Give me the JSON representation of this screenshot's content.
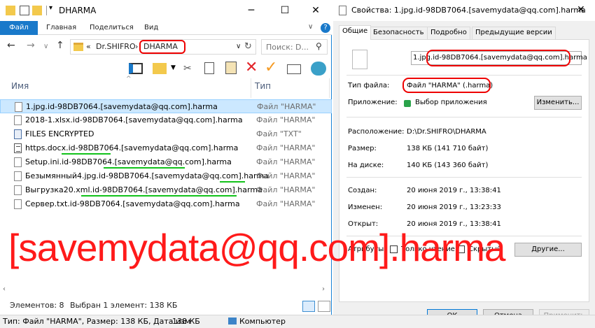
{
  "explorer": {
    "title": "DHARMA",
    "ribbon": {
      "file": "Файл",
      "home": "Главная",
      "share": "Поделиться",
      "view": "Вид",
      "expand": "∨",
      "help": "?"
    },
    "address": {
      "path_sep": "«",
      "parent": "Dr.SHIFRO",
      "arrow": "›",
      "current": "DHARMA"
    },
    "search_placeholder": "Поиск: D...",
    "columns": {
      "name": "Имя",
      "type": "Тип"
    },
    "files": [
      {
        "name": "1.jpg.id-98DB7064.[savemydata@qq.com].harma",
        "type": "Файл \"HARMA\"",
        "selected": true,
        "icon": "file"
      },
      {
        "name": "2018-1.xlsx.id-98DB7064.[savemydata@qq.com].harma",
        "type": "Файл \"HARMA\"",
        "icon": "file"
      },
      {
        "name": "FILES ENCRYPTED",
        "type": "Файл \"TXT\"",
        "icon": "encrypted"
      },
      {
        "name": "https.docx.id-98DB7064.[savemydata@qq.com].harma",
        "type": "Файл \"HARMA\"",
        "icon": "file"
      },
      {
        "name": "Setup.ini.id-98DB7064.[savemydata@qq.com].harma",
        "type": "Файл \"HARMA\"",
        "icon": "file"
      },
      {
        "name": "Безымянный4.jpg.id-98DB7064.[savemydata@qq.com].harma",
        "type": "Файл \"HARMA\"",
        "icon": "file"
      },
      {
        "name": "Выгрузка20.xml.id-98DB7064.[savemydata@qq.com].harma",
        "type": "Файл \"HARMA\"",
        "icon": "file"
      },
      {
        "name": "Сервер.txt.id-98DB7064.[savemydata@qq.com].harma",
        "type": "Файл \"HARMA\"",
        "icon": "file"
      }
    ],
    "status": {
      "count": "Элементов: 8",
      "selected": "Выбран 1 элемент: 138 КБ"
    },
    "overlay_text": "[savemydata@qq.com].harma"
  },
  "bottom_bar": {
    "info": "Тип: Файл \"HARMA\", Размер: 138 КБ, Дата изм",
    "size": "138 КБ",
    "computer": "Компьютер"
  },
  "properties": {
    "title": "Свойства: 1.jpg.id-98DB7064.[savemydata@qq.com].harma",
    "tabs": [
      "Общие",
      "Безопасность",
      "Подробно",
      "Предыдущие версии"
    ],
    "filename": "1.jpg.id-98DB7064.[savemydata@qq.com].harma",
    "file_type_label": "Тип файла:",
    "file_type": "Файл \"HARMA\" (.harma)",
    "app_label": "Приложение:",
    "app_value": "Выбор приложения",
    "change_button": "Изменить...",
    "location_label": "Расположение:",
    "location": "D:\\Dr.SHIFRO\\DHARMA",
    "size_label": "Размер:",
    "size": "138 КБ (141 710 байт)",
    "disk_label": "На диске:",
    "disk": "140 КБ (143 360 байт)",
    "created_label": "Создан:",
    "created": "20 июня 2019 г., 13:38:41",
    "modified_label": "Изменен:",
    "modified": "20 июня 2019 г., 13:23:33",
    "opened_label": "Открыт:",
    "opened": "20 июня 2019 г., 13:38:41",
    "attributes_label": "Атрибуты:",
    "readonly_label": "Только чтение",
    "hidden_label": "Скрытый",
    "other_button": "Другие...",
    "ok": "ОК",
    "cancel": "Отмена",
    "apply": "Применить"
  },
  "colors": {
    "accent": "#1979ca",
    "selection": "#cce8ff",
    "overlay_red": "#ff1a1a",
    "highlight_red": "#e00000",
    "underline_green": "#12c21a"
  }
}
